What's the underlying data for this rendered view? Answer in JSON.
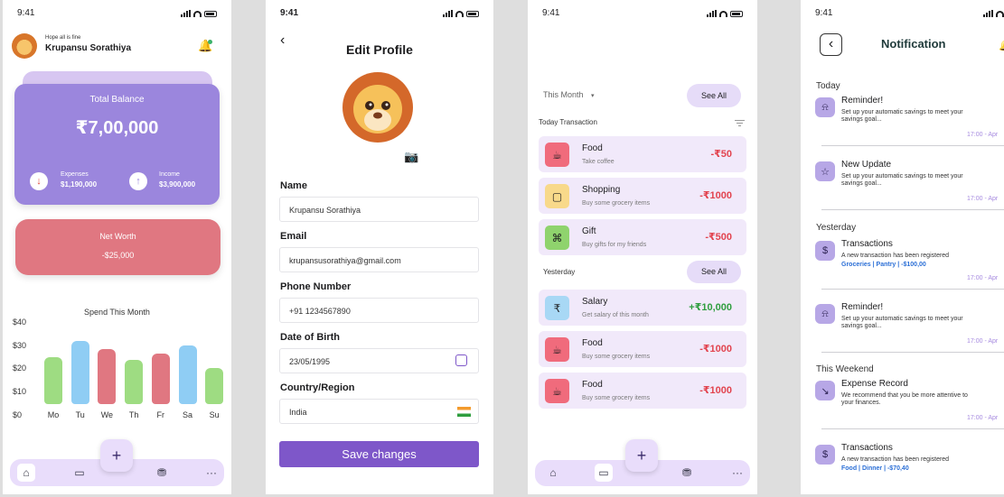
{
  "status_time": "9:41",
  "home": {
    "greeting": "Hope all is fine",
    "user_name": "Krupansu Sorathiya",
    "total_balance_label": "Total Balance",
    "total_balance_value": "₹7,00,000",
    "expenses_label": "Expenses",
    "expenses_value": "$1,190,000",
    "income_label": "Income",
    "income_value": "$3,900,000",
    "net_worth_label": "Net Worth",
    "net_worth_value": "-$25,000",
    "chart_title": "Spend This Month",
    "add_label": "+",
    "nav_icons": [
      "home-icon",
      "card-icon",
      "coins-icon",
      "more-icon"
    ],
    "more_label": "···"
  },
  "chart_data": {
    "type": "bar",
    "title": "Spend This Month",
    "categories": [
      "Mo",
      "Tu",
      "We",
      "Th",
      "Fr",
      "Sa",
      "Su"
    ],
    "values": [
      23,
      31,
      27,
      22,
      25,
      29,
      18
    ],
    "colors": [
      "#9edc82",
      "#8fcdf4",
      "#e07781",
      "#9edc82",
      "#e07781",
      "#8fcdf4",
      "#9edc82"
    ],
    "y_ticks": [
      "$40",
      "$30",
      "$20",
      "$10",
      "$0"
    ],
    "ylim": [
      0,
      40
    ]
  },
  "edit_profile": {
    "back_label": "‹",
    "title": "Edit Profile",
    "name_label": "Name",
    "name_value": "Krupansu Sorathiya",
    "email_label": "Email",
    "email_value": "krupansusorathiya@gmail.com",
    "phone_label": "Phone Number",
    "phone_value": "+91 1234567890",
    "dob_label": "Date of Birth",
    "dob_value": "23/05/1995",
    "country_label": "Country/Region",
    "country_value": "India",
    "save_label": "Save changes"
  },
  "transactions": {
    "period_label": "This Month",
    "see_all_label": "See All",
    "today_label": "Today Transaction",
    "yesterday_label": "Yesterday",
    "today_items": [
      {
        "title": "Food",
        "subtitle": "Take coffee",
        "amount": "-₹50",
        "icon": "coffee-icon",
        "icon_bg": "#f06b7c",
        "amount_color": "#e2444f"
      },
      {
        "title": "Shopping",
        "subtitle": "Buy some grocery items",
        "amount": "-₹1000",
        "icon": "bag-icon",
        "icon_bg": "#f8d98a",
        "amount_color": "#e2444f"
      },
      {
        "title": "Gift",
        "subtitle": "Buy gifts for my friends",
        "amount": "-₹500",
        "icon": "gift-icon",
        "icon_bg": "#8fd36d",
        "amount_color": "#e2444f"
      }
    ],
    "yesterday_items": [
      {
        "title": "Salary",
        "subtitle": "Get salary of this month",
        "amount": "+₹10,000",
        "icon": "rupee-icon",
        "icon_bg": "#a8d8f5",
        "amount_color": "#2f9e3f"
      },
      {
        "title": "Food",
        "subtitle": "Buy some grocery items",
        "amount": "-₹1000",
        "icon": "coffee-icon",
        "icon_bg": "#f06b7c",
        "amount_color": "#e2444f"
      },
      {
        "title": "Food",
        "subtitle": "Buy some grocery items",
        "amount": "-₹1000",
        "icon": "coffee-icon",
        "icon_bg": "#f06b7c",
        "amount_color": "#e2444f"
      }
    ],
    "add_label": "+",
    "more_label": "···"
  },
  "notification": {
    "back_label": "‹",
    "title": "Notification",
    "sections": {
      "today": "Today",
      "yesterday": "Yesterday",
      "weekend": "This Weekend"
    },
    "items": [
      {
        "title": "Reminder!",
        "body": "Set up your automatic savings to meet your savings goal...",
        "time": "17:00 - Apr",
        "icon": "bell-icon"
      },
      {
        "title": "New Update",
        "body": "Set up your automatic savings to meet your savings goal...",
        "time": "17:00 - Apr",
        "icon": "star-icon"
      },
      {
        "title": "Transactions",
        "body": "A new transaction has been registered",
        "tags": "Groceries | Pantry  | -$100,00",
        "time": "17:00 - Apr",
        "icon": "dollar-icon"
      },
      {
        "title": "Reminder!",
        "body": "Set up your automatic savings to meet your savings goal...",
        "time": "17:00 - Apr",
        "icon": "bell-icon"
      },
      {
        "title": "Expense Record",
        "body": "We recommend that you be more attentive to your finances.",
        "time": "17:00 - Apr",
        "icon": "arrow-down-icon"
      },
      {
        "title": "Transactions",
        "body": "A new transaction has been registered",
        "tags": "Food | Dinner  | -$70,40",
        "icon": "dollar-icon"
      }
    ]
  }
}
